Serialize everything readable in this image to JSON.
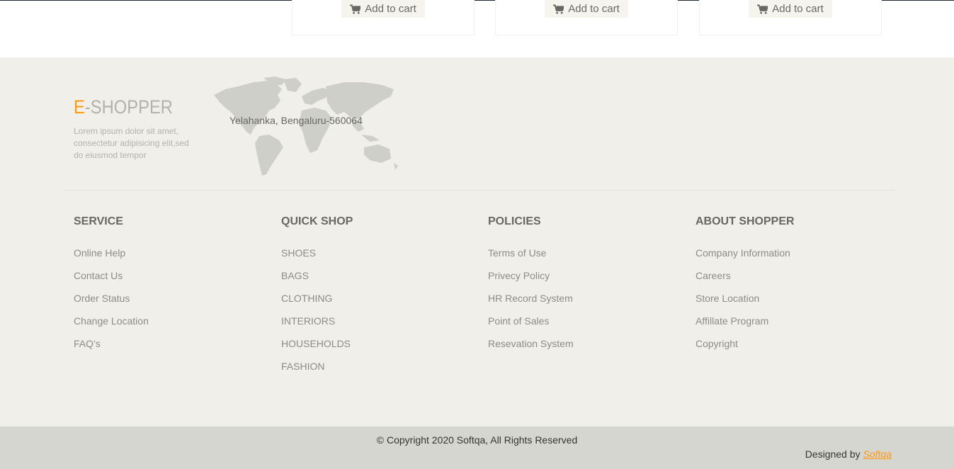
{
  "products": {
    "cards": [
      {
        "add_to_cart_label": "Add to cart"
      },
      {
        "add_to_cart_label": "Add to cart"
      },
      {
        "add_to_cart_label": "Add to cart"
      }
    ]
  },
  "footer_top": {
    "brand_prefix": "E",
    "brand_suffix": "-SHOPPER",
    "description": "Lorem ipsum dolor sit amet, consectetur adipisicing elit,sed do eiusmod tempor",
    "address": "Yelahanka, Bengaluru-560064"
  },
  "columns": [
    {
      "title": "SERVICE",
      "items": [
        "Online Help",
        "Contact Us",
        "Order Status",
        "Change Location",
        "FAQ’s"
      ]
    },
    {
      "title": "QUICK SHOP",
      "items": [
        "SHOES",
        "BAGS",
        "CLOTHING",
        "INTERIORS",
        "HOUSEHOLDS",
        "FASHION"
      ]
    },
    {
      "title": "POLICIES",
      "items": [
        "Terms of Use",
        "Privecy Policy",
        "HR Record System",
        "Point of Sales",
        "Resevation System"
      ]
    },
    {
      "title": "ABOUT SHOPPER",
      "items": [
        "Company Information",
        "Careers",
        "Store Location",
        "Affillate Program",
        "Copyright"
      ]
    }
  ],
  "footer_bottom": {
    "copyright": "© Copyright 2020 Softqa, All Rights Reserved",
    "designed_by_prefix": "Designed by",
    "designed_by_link": "Softqa"
  },
  "colors": {
    "accent": "#fe980f",
    "footer_bg": "#f0efe9",
    "bottom_bar_bg": "#d6d6d0"
  }
}
